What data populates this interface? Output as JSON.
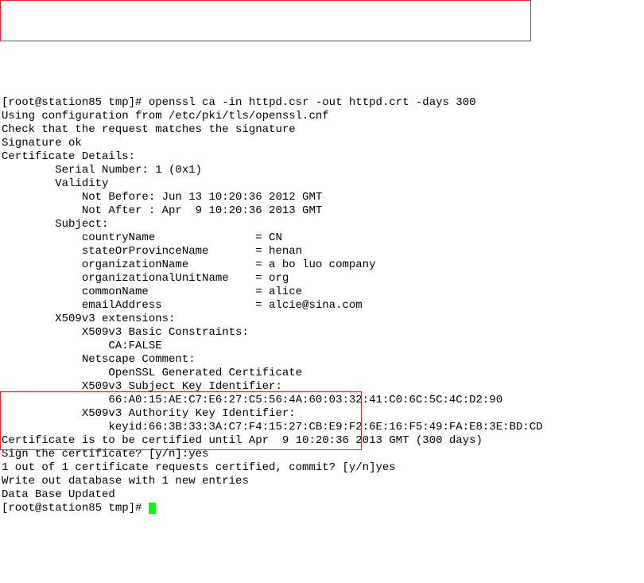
{
  "prompt1": "[root@station85 tmp]# ",
  "cmd1": "openssl ca -in httpd.csr -out httpd.crt -days 300",
  "l2": "Using configuration from /etc/pki/tls/openssl.cnf",
  "l3": "Check that the request matches the signature",
  "l4": "Signature ok",
  "l5": "Certificate Details:",
  "l6": "        Serial Number: 1 (0x1)",
  "l7": "        Validity",
  "l8": "            Not Before: Jun 13 10:20:36 2012 GMT",
  "l9": "            Not After : Apr  9 10:20:36 2013 GMT",
  "l10": "        Subject:",
  "l11": "            countryName               = CN",
  "l12": "            stateOrProvinceName       = henan",
  "l13": "            organizationName          = a bo luo company",
  "l14": "            organizationalUnitName    = org",
  "l15": "            commonName                = alice",
  "l16": "            emailAddress              = alcie@sina.com",
  "l17": "        X509v3 extensions:",
  "l18": "            X509v3 Basic Constraints:",
  "l19": "                CA:FALSE",
  "l20": "            Netscape Comment:",
  "l21": "                OpenSSL Generated Certificate",
  "l22": "            X509v3 Subject Key Identifier:",
  "l23": "                66:A0:15:AE:C7:E6:27:C5:56:4A:60:03:32:41:C0:6C:5C:4C:D2:90",
  "l24": "            X509v3 Authority Key Identifier:",
  "l25": "                keyid:66:3B:33:3A:C7:F4:15:27:CB:E9:F2:6E:16:F5:49:FA:E8:3E:BD:CD",
  "l26": "",
  "l27": "Certificate is to be certified until Apr  9 10:20:36 2013 GMT (300 days)",
  "l28": "Sign the certificate? [y/n]:yes",
  "l29": "",
  "l30": "",
  "l31": "1 out of 1 certificate requests certified, commit? [y/n]yes",
  "l32": "Write out database with 1 new entries",
  "l33": "Data Base Updated",
  "prompt2": "[root@station85 tmp]# "
}
